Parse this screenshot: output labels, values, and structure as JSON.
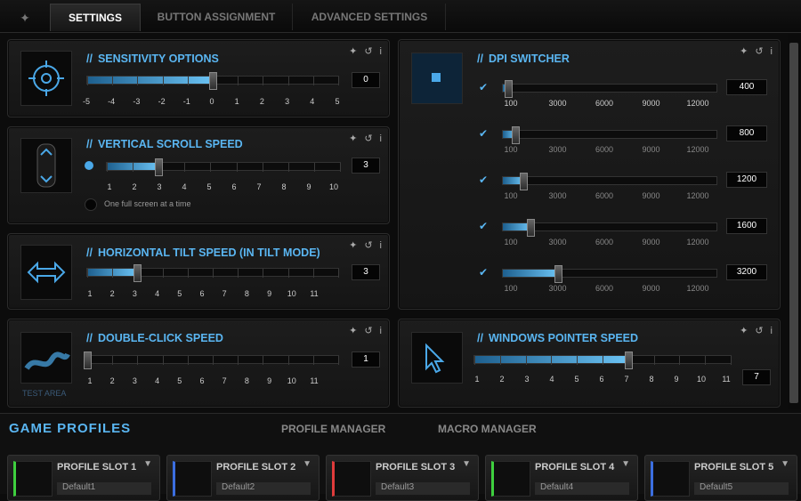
{
  "tabs": {
    "settings": "SETTINGS",
    "buttons": "BUTTON ASSIGNMENT",
    "advanced": "ADVANCED SETTINGS"
  },
  "sensitivity": {
    "title": "SENSITIVITY OPTIONS",
    "value": "0",
    "labels": [
      "-5",
      "-4",
      "-3",
      "-2",
      "-1",
      "0",
      "1",
      "2",
      "3",
      "4",
      "5"
    ],
    "fraction": 0.5
  },
  "scroll": {
    "title": "VERTICAL SCROLL SPEED",
    "value": "3",
    "labels": [
      "1",
      "2",
      "3",
      "4",
      "5",
      "6",
      "7",
      "8",
      "9",
      "10"
    ],
    "fraction": 0.22,
    "option": "One full screen at a time"
  },
  "tilt": {
    "title": "HORIZONTAL TILT SPEED (IN TILT MODE)",
    "value": "3",
    "labels": [
      "1",
      "2",
      "3",
      "4",
      "5",
      "6",
      "7",
      "8",
      "9",
      "10",
      "11"
    ],
    "fraction": 0.2
  },
  "dblclick": {
    "title": "DOUBLE-CLICK SPEED",
    "value": "1",
    "labels": [
      "1",
      "2",
      "3",
      "4",
      "5",
      "6",
      "7",
      "8",
      "9",
      "10",
      "11"
    ],
    "fraction": 0.0,
    "test_area": "TEST AREA"
  },
  "dpi": {
    "title": "DPI SWITCHER",
    "scale": [
      "100",
      "3000",
      "6000",
      "9000",
      "12000"
    ],
    "rows": [
      {
        "value": "400",
        "fraction": 0.025
      },
      {
        "value": "800",
        "fraction": 0.06
      },
      {
        "value": "1200",
        "fraction": 0.095
      },
      {
        "value": "1600",
        "fraction": 0.13
      },
      {
        "value": "3200",
        "fraction": 0.26
      }
    ]
  },
  "pointer": {
    "title": "WINDOWS POINTER SPEED",
    "value": "7",
    "labels": [
      "1",
      "2",
      "3",
      "4",
      "5",
      "6",
      "7",
      "8",
      "9",
      "10",
      "11"
    ],
    "fraction": 0.6
  },
  "bottom": {
    "game_profiles": "GAME PROFILES",
    "profile_manager": "PROFILE MANAGER",
    "macro_manager": "MACRO MANAGER"
  },
  "slots": [
    {
      "name": "PROFILE SLOT 1",
      "default": "Default1",
      "color": "#3ecf3e"
    },
    {
      "name": "PROFILE SLOT 2",
      "default": "Default2",
      "color": "#3b6ee0"
    },
    {
      "name": "PROFILE SLOT 3",
      "default": "Default3",
      "color": "#e03b3b"
    },
    {
      "name": "PROFILE SLOT 4",
      "default": "Default4",
      "color": "#3ecf3e"
    },
    {
      "name": "PROFILE SLOT 5",
      "default": "Default5",
      "color": "#3b6ee0"
    }
  ],
  "icons": {
    "pin": "pin-icon",
    "reset": "reset-icon",
    "info": "info-icon"
  }
}
